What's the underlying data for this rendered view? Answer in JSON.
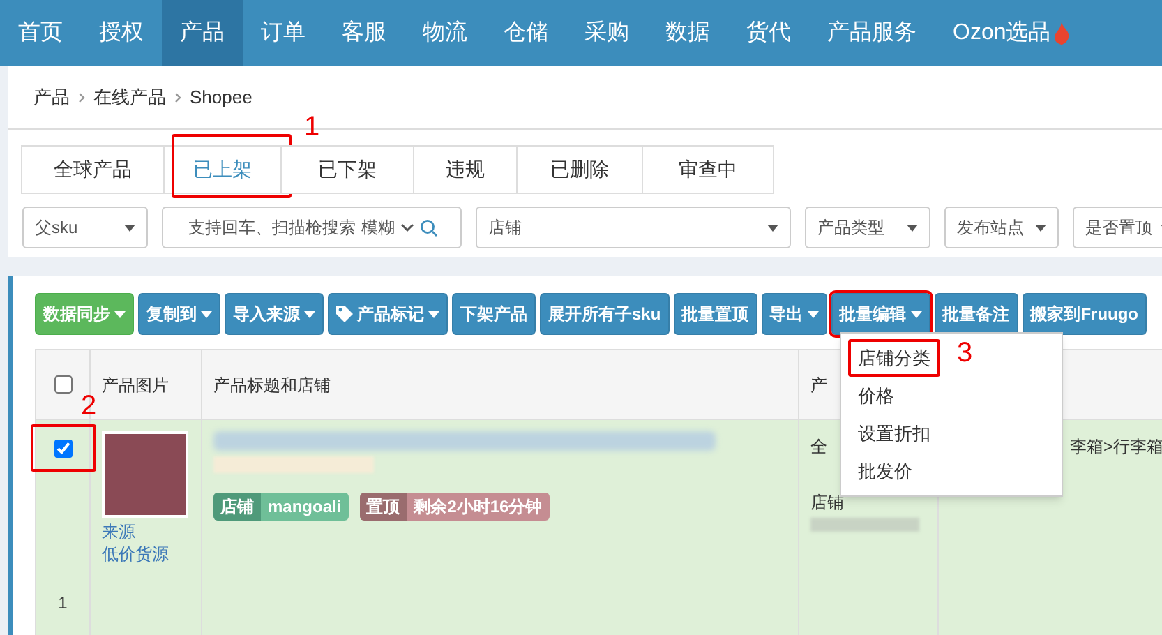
{
  "nav": {
    "items": [
      {
        "label": "首页",
        "selected": false
      },
      {
        "label": "授权",
        "selected": false
      },
      {
        "label": "产品",
        "selected": true
      },
      {
        "label": "订单",
        "selected": false
      },
      {
        "label": "客服",
        "selected": false
      },
      {
        "label": "物流",
        "selected": false
      },
      {
        "label": "仓储",
        "selected": false
      },
      {
        "label": "采购",
        "selected": false
      },
      {
        "label": "数据",
        "selected": false
      },
      {
        "label": "货代",
        "selected": false
      },
      {
        "label": "产品服务",
        "selected": false
      },
      {
        "label": "Ozon选品",
        "selected": false
      }
    ]
  },
  "breadcrumb": [
    "产品",
    "在线产品",
    "Shopee"
  ],
  "tabs": [
    {
      "label": "全球产品",
      "selected": false
    },
    {
      "label": "已上架",
      "selected": true
    },
    {
      "label": "已下架",
      "selected": false
    },
    {
      "label": "违规",
      "selected": false
    },
    {
      "label": "已删除",
      "selected": false
    },
    {
      "label": "审查中",
      "selected": false
    }
  ],
  "filters": [
    {
      "kind": "select",
      "value": "父sku"
    },
    {
      "kind": "search",
      "placeholder": "支持回车、扫描枪搜索",
      "mode": "模糊"
    },
    {
      "kind": "select",
      "value": "店铺"
    },
    {
      "kind": "select",
      "value": "产品类型"
    },
    {
      "kind": "select",
      "value": "发布站点"
    },
    {
      "kind": "select",
      "value": "是否置顶"
    }
  ],
  "toolbar": [
    {
      "label": "数据同步",
      "kind": "success",
      "caret": true,
      "open": false
    },
    {
      "label": "复制到",
      "kind": "primary",
      "caret": true,
      "open": false
    },
    {
      "label": "导入来源",
      "kind": "primary",
      "caret": true,
      "open": false
    },
    {
      "label": "产品标记",
      "kind": "tag",
      "caret": true,
      "open": false
    },
    {
      "label": "下架产品",
      "kind": "primary",
      "caret": false,
      "open": false
    },
    {
      "label": "展开所有子sku",
      "kind": "primary",
      "caret": false,
      "open": false
    },
    {
      "label": "批量置顶",
      "kind": "primary",
      "caret": false,
      "open": false
    },
    {
      "label": "导出",
      "kind": "primary",
      "caret": true,
      "open": false
    },
    {
      "label": "批量编辑",
      "kind": "primary",
      "caret": true,
      "open": true
    },
    {
      "label": "批量备注",
      "kind": "primary",
      "caret": false,
      "open": false
    },
    {
      "label": "搬家到Fruugo",
      "kind": "primary",
      "caret": false,
      "open": false
    }
  ],
  "dropdown": {
    "items": [
      {
        "label": "店铺分类",
        "highlighted": true
      },
      {
        "label": "价格",
        "highlighted": false
      },
      {
        "label": "设置折扣",
        "highlighted": false
      },
      {
        "label": "批发价",
        "highlighted": false
      }
    ]
  },
  "table": {
    "columns": [
      {
        "checked": false
      },
      {
        "label": "产品图片"
      },
      {
        "label": "产品标题和店铺"
      },
      {
        "label": "产"
      }
    ],
    "rows": [
      {
        "checked": true,
        "source_label": "来源",
        "source_value": "低价货源",
        "index": "1",
        "shop_tag": "店铺",
        "shop": "mangoali",
        "top_tag": "置顶",
        "top_remaining": "剩余2小时16分钟",
        "column_4": "全",
        "column_4_label": "店铺",
        "column_5": "李箱>行李箱"
      }
    ]
  },
  "annotations": [
    "1",
    "2",
    "3"
  ]
}
